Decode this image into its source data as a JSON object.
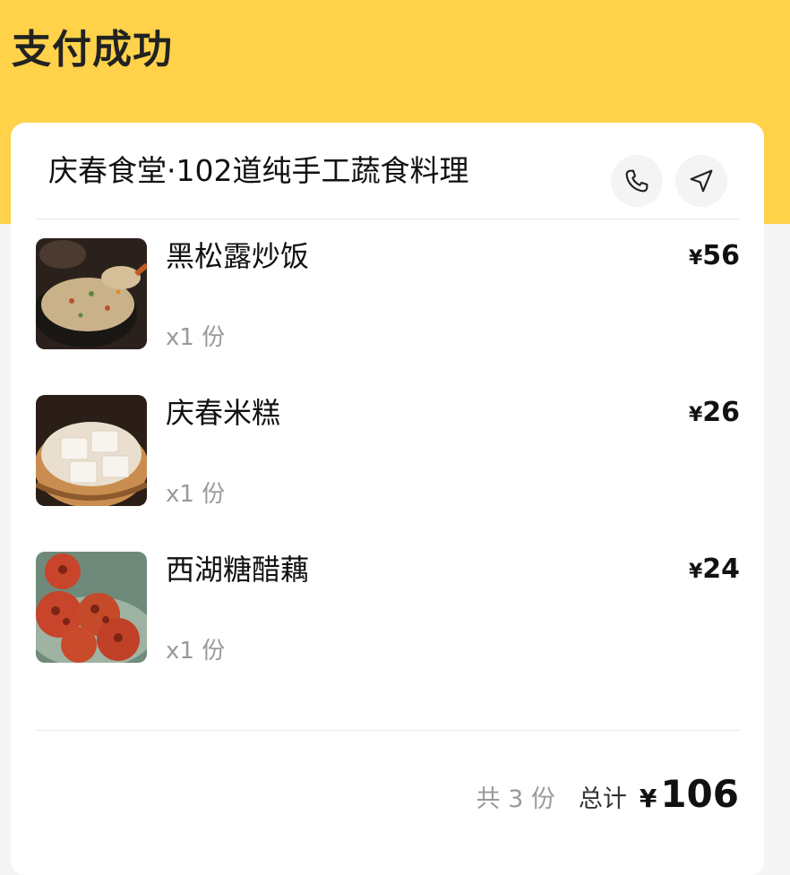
{
  "header": {
    "title": "支付成功"
  },
  "store": {
    "name": "庆春食堂·102道纯手工蔬食料理",
    "phone_icon": "phone-icon",
    "nav_icon": "navigation-icon"
  },
  "items": [
    {
      "name": "黑松露炒饭",
      "qty": "x1 份",
      "currency": "¥",
      "price": "56"
    },
    {
      "name": "庆春米糕",
      "qty": "x1 份",
      "currency": "¥",
      "price": "26"
    },
    {
      "name": "西湖糖醋藕",
      "qty": "x1 份",
      "currency": "¥",
      "price": "24"
    }
  ],
  "summary": {
    "count_text": "共 3 份",
    "total_label": "总计",
    "currency": "¥",
    "total": "106"
  },
  "colors": {
    "header_bg": "#ffd24a",
    "card_bg": "#ffffff",
    "page_bg": "#f5f5f5",
    "muted_text": "#9a9a9a"
  }
}
